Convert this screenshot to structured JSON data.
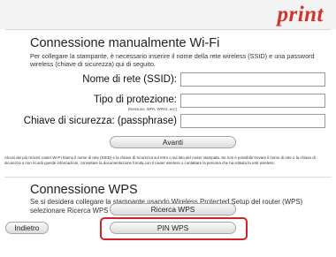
{
  "header": {
    "logo_text": "print"
  },
  "manual": {
    "title": "Connessione manualmente Wi-Fi",
    "description": "Per collegare la stampante, è necessario inserire il nome della rete wireless (SSID) e una password wireless (chiave di sicurezza) qui di seguito.",
    "ssid_label": "Nome di rete (SSID):",
    "ssid_value": "",
    "protection_label": "Tipo di protezione:",
    "protection_sublabel": "(Nessuno, WPA, WPA2, ecc)",
    "protection_value": "",
    "key_label": "Chiave di sicurezza: (passphrase)",
    "key_value": "",
    "next_button": "Avanti",
    "note": "Alcuni dei più recenti router Wi-Fi hanno il nome di rete (SSID) e la chiave di sicurezza sul retro o sul lato del router stampata. Se non è possibile trovare il nome di rete o la chiave di sicurezza o non ricordi queste informazioni, consultare la documentazione fornita con il router wireless o contattare la persona che ha istituito la rete wireless."
  },
  "wps": {
    "title": "Connessione WPS",
    "description": "Se si desidera collegare la stampante usando Wireless Protected Setup del router (WPS) selezionare Ricerca WPS o PIN WPS a seconda del tipo di router",
    "search_button": "Ricerca WPS",
    "pin_button": "PIN WPS"
  },
  "footer": {
    "back_button": "Indietro"
  },
  "colors": {
    "accent": "#d2232a",
    "logo": "#d2342c"
  }
}
